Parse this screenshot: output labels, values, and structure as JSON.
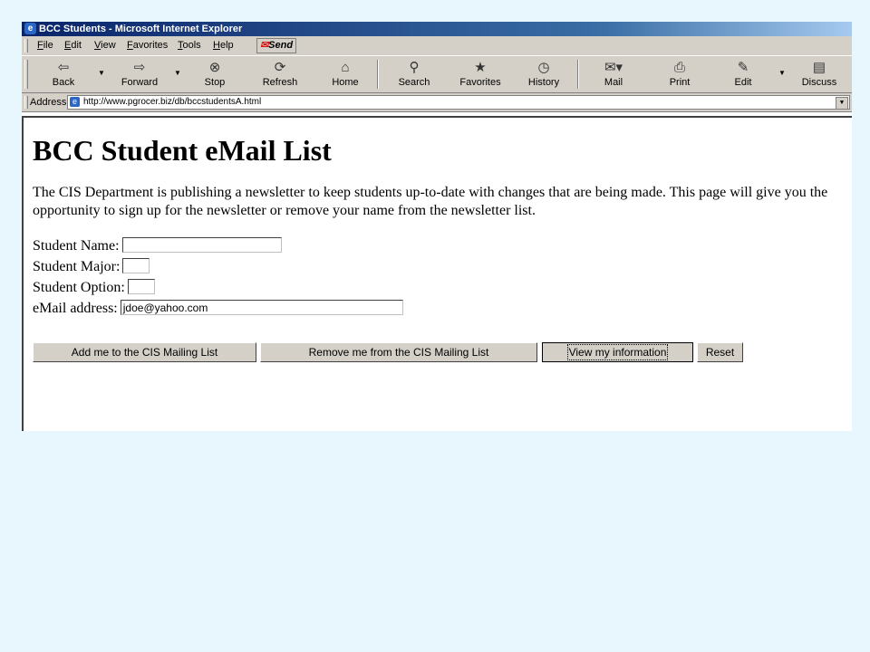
{
  "window": {
    "title": "BCC Students - Microsoft Internet Explorer"
  },
  "menu": {
    "items": [
      "File",
      "Edit",
      "View",
      "Favorites",
      "Tools",
      "Help"
    ],
    "send_label": "Send"
  },
  "toolbar": {
    "back": {
      "label": "Back",
      "icon": "back-arrow-icon"
    },
    "forward": {
      "label": "Forward",
      "icon": "forward-arrow-icon"
    },
    "stop": {
      "label": "Stop",
      "icon": "stop-icon"
    },
    "refresh": {
      "label": "Refresh",
      "icon": "refresh-icon"
    },
    "home": {
      "label": "Home",
      "icon": "home-icon"
    },
    "search": {
      "label": "Search",
      "icon": "search-icon"
    },
    "favorites": {
      "label": "Favorites",
      "icon": "favorites-icon"
    },
    "history": {
      "label": "History",
      "icon": "history-icon"
    },
    "mail": {
      "label": "Mail",
      "icon": "mail-icon"
    },
    "print": {
      "label": "Print",
      "icon": "print-icon"
    },
    "edit": {
      "label": "Edit",
      "icon": "edit-icon"
    },
    "discuss": {
      "label": "Discuss",
      "icon": "discuss-icon"
    }
  },
  "address": {
    "label": "Address",
    "url": "http://www.pgrocer.biz/db/bccstudentsA.html"
  },
  "page": {
    "heading": "BCC Student eMail List",
    "intro": "The CIS Department is publishing a newsletter to keep students up-to-date with changes that are being made. This page will give you the opportunity to sign up for the newsletter or remove your name from the newsletter list.",
    "fields": {
      "name": {
        "label": "Student Name:",
        "value": ""
      },
      "major": {
        "label": "Student Major:",
        "value": ""
      },
      "option": {
        "label": "Student Option:",
        "value": ""
      },
      "email": {
        "label": "eMail address:",
        "value": "jdoe@yahoo.com"
      }
    },
    "buttons": {
      "add": "Add me to the CIS Mailing List",
      "remove": "Remove me from the CIS Mailing List",
      "view": "View my information",
      "reset": "Reset"
    }
  },
  "colors": {
    "background": "#e8f6fd",
    "chrome": "#d4d0c8",
    "titlebar": "#0a246a"
  }
}
